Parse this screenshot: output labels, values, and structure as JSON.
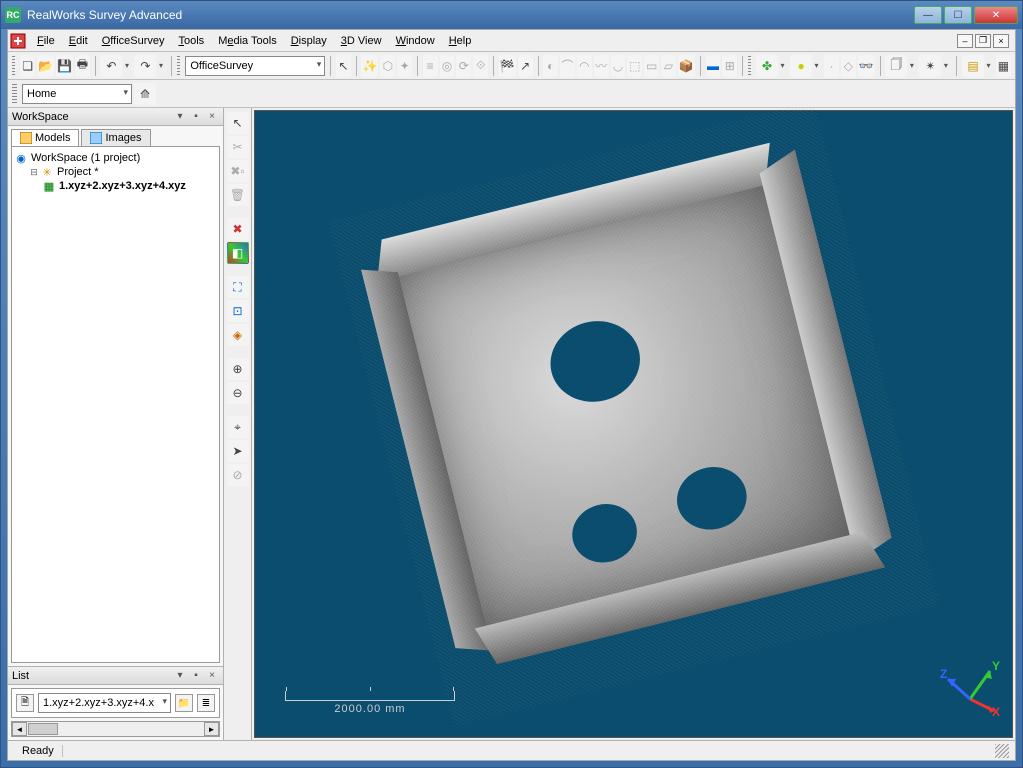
{
  "window": {
    "title": "RealWorks Survey Advanced"
  },
  "menu": {
    "items": [
      {
        "label": "File",
        "u": 0
      },
      {
        "label": "Edit",
        "u": 0
      },
      {
        "label": "OfficeSurvey",
        "u": 0
      },
      {
        "label": "Tools",
        "u": 0
      },
      {
        "label": "Media Tools",
        "u": 1
      },
      {
        "label": "Display",
        "u": 0
      },
      {
        "label": "3D View",
        "u": 0
      },
      {
        "label": "Window",
        "u": 0
      },
      {
        "label": "Help",
        "u": 0
      }
    ]
  },
  "toolbar1": {
    "module_combo": "OfficeSurvey"
  },
  "toolbar2": {
    "home_combo": "Home"
  },
  "workspace": {
    "title": "WorkSpace",
    "tabs": {
      "models": "Models",
      "images": "Images"
    },
    "tree": {
      "root": "WorkSpace (1 project)",
      "project": "Project  *",
      "file": "1.xyz+2.xyz+3.xyz+4.xyz"
    }
  },
  "list": {
    "title": "List",
    "combo": "1.xyz+2.xyz+3.xyz+4.x"
  },
  "viewport": {
    "scale_label": "2000.00 mm",
    "axes": {
      "x": "X",
      "y": "Y",
      "z": "Z"
    }
  },
  "status": {
    "ready": "Ready"
  },
  "icons": {
    "new": "❏",
    "open": "📂",
    "save": "💾",
    "print": "🖶",
    "undo": "↶",
    "redo": "↷",
    "pointer": "↖",
    "pick": "✥",
    "pan": "✥",
    "rot": "⟲",
    "zoom": "🔍",
    "fit": "▣",
    "home": "⌂",
    "fly": "✈",
    "cut": "✂",
    "del": "🗑",
    "x": "✕",
    "add": "+",
    "tree": "◉",
    "proj": "✳",
    "doc": "▦",
    "layers": "≣",
    "box": "▢",
    "globe": "🌐",
    "measure": "📏",
    "cloud": "☁",
    "cube": "⬚",
    "eye": "👁",
    "gear": "⚙",
    "zoom_in": "⊕",
    "zoom_out": "⊖",
    "target": "◎",
    "frame": "▭",
    "axis": "✛",
    "arrow_l": "◄",
    "arrow_r": "►",
    "wand": "✨",
    "color": "◧",
    "sphere": "●",
    "chev": "▾",
    "pin": "📌",
    "close_s": "✕",
    "minimize": "—",
    "maximize": "☐",
    "close": "✕",
    "restore": "❐",
    "app": "RC"
  }
}
